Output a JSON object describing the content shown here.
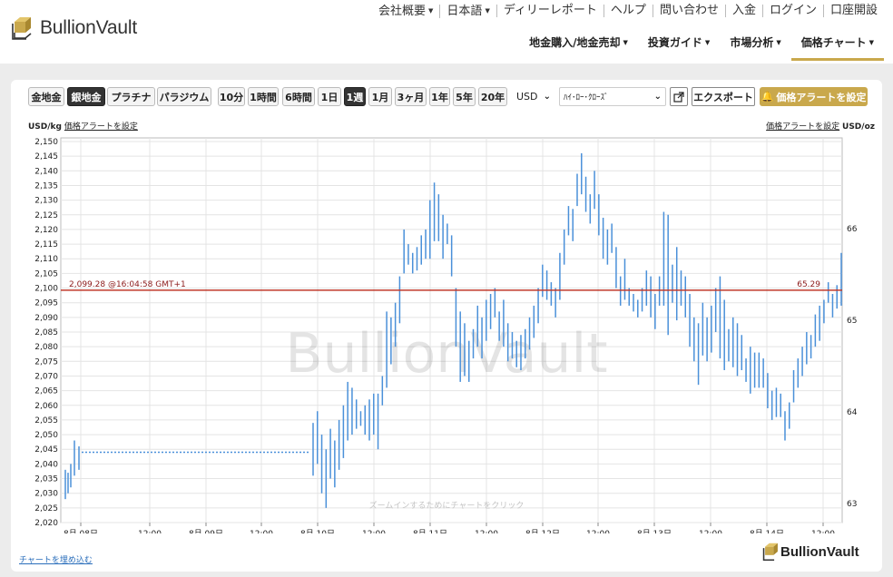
{
  "header": {
    "brand": "BullionVault",
    "top_nav": [
      "会社概要",
      "日本語",
      "ディリーレポート",
      "ヘルプ",
      "問い合わせ",
      "入金",
      "ログイン",
      "口座開設"
    ],
    "top_nav_dropdown": [
      true,
      true,
      false,
      false,
      false,
      false,
      false,
      false
    ],
    "main_nav": [
      "地金購入/地金売却",
      "投資ガイド",
      "市場分析",
      "価格チャート"
    ],
    "main_nav_active": 3
  },
  "toolbar": {
    "metals": [
      "金地金",
      "銀地金",
      "プラチナ",
      "パラジウム"
    ],
    "selected_metal": 1,
    "ranges": [
      "10分",
      "1時間",
      "6時間",
      "1日",
      "1週",
      "1月",
      "3ヶ月",
      "1年",
      "5年",
      "20年"
    ],
    "selected_range": 4,
    "currency": "USD",
    "chart_style": "ﾊｲ･ﾛｰ･ｸﾛｰｽﾞ",
    "export_label": "エクスポート",
    "alert_label": "価格アラートを設定"
  },
  "labels": {
    "left_unit": "USD/kg",
    "left_alert_link": "価格アラートを設定",
    "right_unit": "USD/oz",
    "right_alert_link": "価格アラートを設定",
    "current_label": "2,099.28 @16:04:58 GMT+1",
    "current_right": "65.29",
    "zoom_hint": "ズームインするためにチャートをクリック",
    "watermark": "BullionVault",
    "embed_link": "チャートを埋め込む",
    "footer_brand": "BullionVault"
  },
  "colors": {
    "accent": "#c9a84c",
    "bar": "#4a90d9",
    "current_line": "#c0392b"
  },
  "chart_data": {
    "type": "hlc",
    "title": "",
    "y_left_label": "USD/kg",
    "y_right_label": "USD/oz",
    "ylim_left": [
      2020,
      2150
    ],
    "y_left_ticks": [
      "2,020",
      "2,025",
      "2,030",
      "2,035",
      "2,040",
      "2,045",
      "2,050",
      "2,055",
      "2,060",
      "2,065",
      "2,070",
      "2,075",
      "2,080",
      "2,085",
      "2,090",
      "2,095",
      "2,100",
      "2,105",
      "2,110",
      "2,115",
      "2,120",
      "2,125",
      "2,130",
      "2,135",
      "2,140",
      "2,145",
      "2,150"
    ],
    "y_right_ticks": [
      "63",
      "64",
      "65",
      "66"
    ],
    "x_tick_labels": [
      "8月 08日",
      "12:00",
      "8月 09日",
      "12:00",
      "8月 10日",
      "12:00",
      "8月 11日",
      "12:00",
      "8月 12日",
      "12:00",
      "8月 13日",
      "12:00",
      "8月 14日",
      "12:00"
    ],
    "current_value": 2099.28,
    "current_time": "16:04:58 GMT+1",
    "current_value_oz": 65.29,
    "flat_segment": {
      "value": 2044,
      "description": "dotted weekend gap"
    },
    "series": [
      {
        "values_hl": [
          [
            2038,
            2028
          ],
          [
            2037,
            2030
          ],
          [
            2040,
            2032
          ],
          [
            2048,
            2036
          ],
          [
            2046,
            2038
          ],
          [
            2054,
            2036
          ],
          [
            2058,
            2040
          ],
          [
            2050,
            2030
          ],
          [
            2045,
            2025
          ],
          [
            2052,
            2035
          ],
          [
            2048,
            2032
          ],
          [
            2055,
            2038
          ],
          [
            2060,
            2042
          ],
          [
            2068,
            2048
          ],
          [
            2066,
            2050
          ],
          [
            2062,
            2052
          ],
          [
            2058,
            2053
          ],
          [
            2060,
            2050
          ],
          [
            2062,
            2048
          ],
          [
            2064,
            2050
          ],
          [
            2064,
            2045
          ],
          [
            2070,
            2060
          ],
          [
            2092,
            2066
          ],
          [
            2090,
            2074
          ],
          [
            2095,
            2080
          ],
          [
            2104,
            2088
          ],
          [
            2120,
            2105
          ],
          [
            2115,
            2108
          ],
          [
            2112,
            2105
          ],
          [
            2114,
            2106
          ],
          [
            2118,
            2108
          ],
          [
            2120,
            2110
          ],
          [
            2130,
            2110
          ],
          [
            2136,
            2116
          ],
          [
            2132,
            2116
          ],
          [
            2125,
            2110
          ],
          [
            2122,
            2115
          ],
          [
            2118,
            2104
          ],
          [
            2100,
            2080
          ],
          [
            2092,
            2068
          ],
          [
            2088,
            2070
          ],
          [
            2082,
            2068
          ],
          [
            2086,
            2076
          ],
          [
            2094,
            2080
          ],
          [
            2090,
            2076
          ],
          [
            2096,
            2082
          ],
          [
            2098,
            2086
          ],
          [
            2100,
            2090
          ],
          [
            2092,
            2082
          ],
          [
            2096,
            2080
          ],
          [
            2088,
            2075
          ],
          [
            2085,
            2076
          ],
          [
            2082,
            2073
          ],
          [
            2084,
            2072
          ],
          [
            2086,
            2076
          ],
          [
            2090,
            2079
          ],
          [
            2094,
            2083
          ],
          [
            2100,
            2088
          ],
          [
            2108,
            2097
          ],
          [
            2106,
            2096
          ],
          [
            2102,
            2094
          ],
          [
            2100,
            2090
          ],
          [
            2112,
            2096
          ],
          [
            2120,
            2108
          ],
          [
            2128,
            2118
          ],
          [
            2127,
            2116
          ],
          [
            2139,
            2128
          ],
          [
            2146,
            2132
          ],
          [
            2138,
            2126
          ],
          [
            2132,
            2122
          ],
          [
            2140,
            2127
          ],
          [
            2132,
            2118
          ],
          [
            2124,
            2110
          ],
          [
            2120,
            2108
          ],
          [
            2122,
            2112
          ],
          [
            2114,
            2100
          ],
          [
            2104,
            2094
          ],
          [
            2110,
            2096
          ],
          [
            2100,
            2094
          ],
          [
            2098,
            2092
          ],
          [
            2096,
            2090
          ],
          [
            2100,
            2092
          ],
          [
            2106,
            2094
          ],
          [
            2104,
            2090
          ],
          [
            2098,
            2086
          ],
          [
            2104,
            2094
          ],
          [
            2126,
            2094
          ],
          [
            2125,
            2084
          ],
          [
            2108,
            2095
          ],
          [
            2114,
            2089
          ],
          [
            2106,
            2094
          ],
          [
            2104,
            2090
          ],
          [
            2098,
            2080
          ],
          [
            2090,
            2075
          ],
          [
            2088,
            2067
          ],
          [
            2095,
            2077
          ],
          [
            2090,
            2075
          ],
          [
            2094,
            2078
          ],
          [
            2100,
            2085
          ],
          [
            2104,
            2076
          ],
          [
            2096,
            2072
          ],
          [
            2086,
            2075
          ],
          [
            2090,
            2073
          ],
          [
            2088,
            2070
          ],
          [
            2084,
            2072
          ],
          [
            2076,
            2068
          ],
          [
            2080,
            2064
          ],
          [
            2078,
            2066
          ],
          [
            2078,
            2066
          ],
          [
            2076,
            2066
          ],
          [
            2071,
            2059
          ],
          [
            2065,
            2055
          ],
          [
            2066,
            2056
          ],
          [
            2064,
            2056
          ],
          [
            2058,
            2048
          ],
          [
            2061,
            2052
          ],
          [
            2072,
            2061
          ],
          [
            2076,
            2066
          ],
          [
            2080,
            2070
          ],
          [
            2085,
            2074
          ],
          [
            2084,
            2076
          ],
          [
            2091,
            2080
          ],
          [
            2094,
            2082
          ],
          [
            2096,
            2088
          ],
          [
            2102,
            2095
          ],
          [
            2098,
            2090
          ],
          [
            2101,
            2093
          ],
          [
            2112,
            2094
          ]
        ]
      }
    ]
  }
}
